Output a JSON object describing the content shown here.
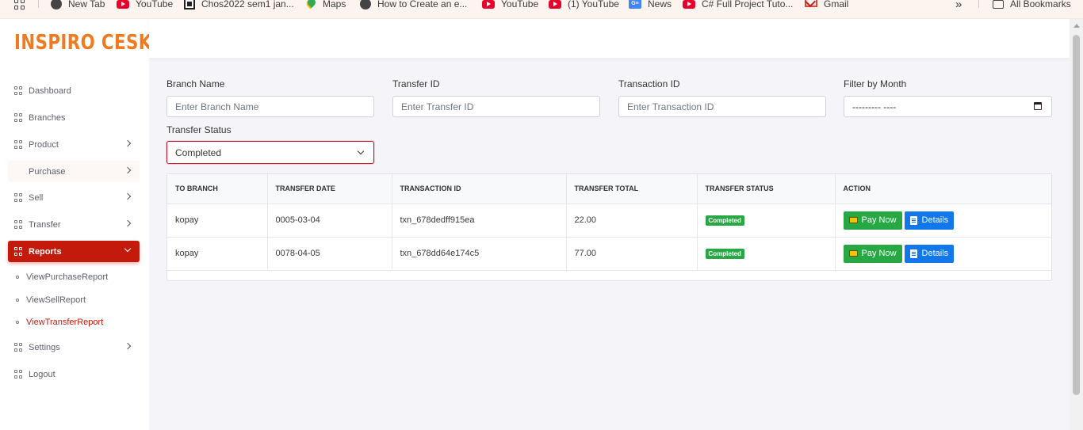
{
  "bookmarks": [
    {
      "label": "",
      "icon": "apps-grid-icon"
    },
    {
      "label": "New Tab",
      "icon": "globe-icon"
    },
    {
      "label": "YouTube",
      "icon": "youtube-icon"
    },
    {
      "label": "Chos2022 sem1 jan...",
      "icon": "qr-icon"
    },
    {
      "label": "Maps",
      "icon": "maps-pin-icon"
    },
    {
      "label": "How to Create an e...",
      "icon": "globe-icon"
    },
    {
      "label": "YouTube",
      "icon": "youtube-icon"
    },
    {
      "label": "(1) YouTube",
      "icon": "youtube-icon"
    },
    {
      "label": "News",
      "icon": "google-news-icon"
    },
    {
      "label": "C# Full Project Tuto...",
      "icon": "youtube-icon"
    },
    {
      "label": "Gmail",
      "icon": "gmail-icon"
    }
  ],
  "bookmarks_overflow": "»",
  "all_bookmarks": "All Bookmarks",
  "brand": {
    "name": "INSPIRO CESK",
    "color": "#f07a1f"
  },
  "sidebar": {
    "items": [
      {
        "label": "Dashboard",
        "has_chevron": false
      },
      {
        "label": "Branches",
        "has_chevron": false
      },
      {
        "label": "Product",
        "has_chevron": true
      },
      {
        "label": "Purchase",
        "has_chevron": true
      },
      {
        "label": "Sell",
        "has_chevron": true
      },
      {
        "label": "Transfer",
        "has_chevron": true
      },
      {
        "label": "Reports",
        "has_chevron": true,
        "active": true
      },
      {
        "label": "Settings",
        "has_chevron": true
      },
      {
        "label": "Logout",
        "has_chevron": false
      }
    ],
    "report_subitems": [
      {
        "label": "ViewPurchaseReport"
      },
      {
        "label": "ViewSellReport"
      },
      {
        "label": "ViewTransferReport",
        "active": true
      }
    ],
    "active_color": "#c41a0c"
  },
  "filters": {
    "branch_name": {
      "label": "Branch Name",
      "placeholder": "Enter Branch Name"
    },
    "transfer_id": {
      "label": "Transfer ID",
      "placeholder": "Enter Transfer ID"
    },
    "transaction_id": {
      "label": "Transaction ID",
      "placeholder": "Enter Transaction ID"
    },
    "month": {
      "label": "Filter by Month",
      "value": "--------- ----"
    },
    "status": {
      "label": "Transfer Status",
      "value": "Completed"
    }
  },
  "table": {
    "columns": [
      "TO BRANCH",
      "TRANSFER DATE",
      "TRANSACTION ID",
      "TRANSFER TOTAL",
      "TRANSFER STATUS",
      "ACTION"
    ],
    "rows": [
      {
        "to_branch": "kopay",
        "date": "0005-03-04",
        "txn": "txn_678dedff915ea",
        "total": "22.00",
        "status": "Completed"
      },
      {
        "to_branch": "kopay",
        "date": "0078-04-05",
        "txn": "txn_678dd64e174c5",
        "total": "77.00",
        "status": "Completed"
      }
    ],
    "pay_label": "Pay Now",
    "details_label": "Details"
  },
  "colors": {
    "success": "#28a745",
    "primary": "#1277ea"
  }
}
